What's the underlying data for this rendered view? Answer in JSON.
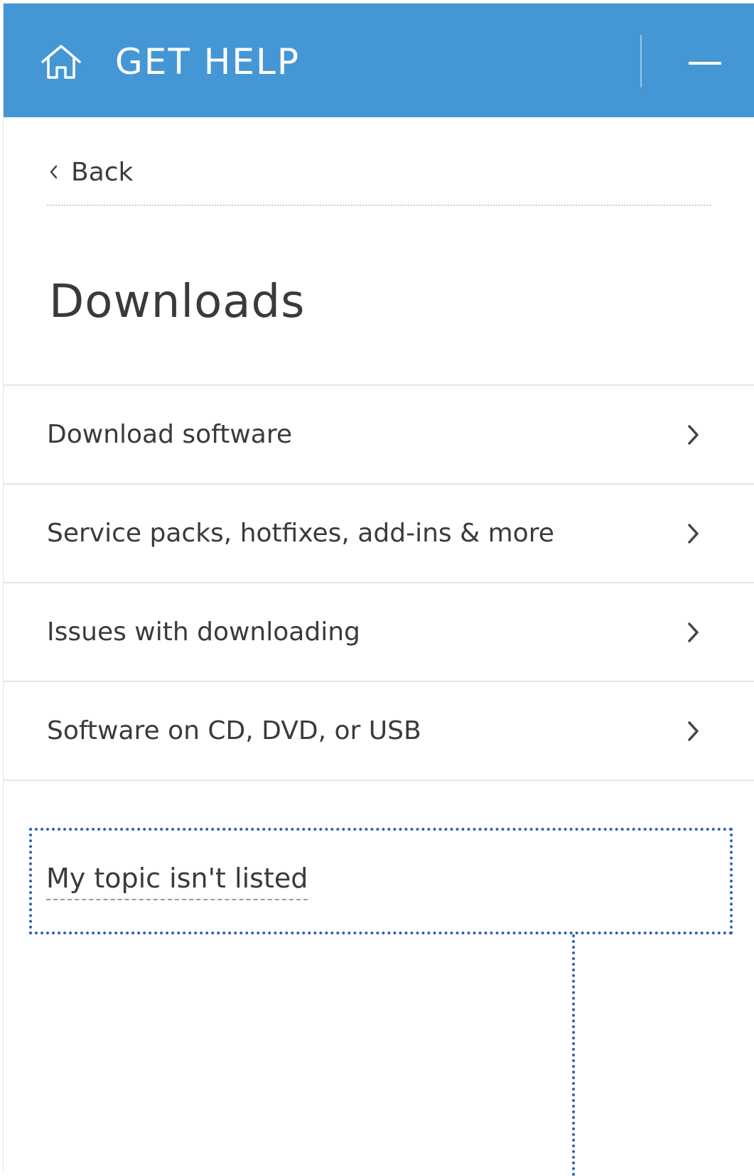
{
  "header": {
    "title": "GET HELP",
    "icon_home": "home-icon",
    "icon_minimize": "minimize-icon",
    "background_color": "#4596d4"
  },
  "navigation": {
    "back_label": "Back",
    "back_icon": "chevron-left-icon"
  },
  "page": {
    "title": "Downloads"
  },
  "topics": [
    {
      "label": "Download software",
      "icon": "chevron-right-icon"
    },
    {
      "label": "Service packs, hotfixes, add-ins & more",
      "icon": "chevron-right-icon"
    },
    {
      "label": "Issues with downloading",
      "icon": "chevron-right-icon"
    },
    {
      "label": "Software on CD, DVD, or USB",
      "icon": "chevron-right-icon"
    }
  ],
  "footer": {
    "not_listed_label": "My topic isn't listed",
    "highlight_color": "#2c63b3"
  }
}
